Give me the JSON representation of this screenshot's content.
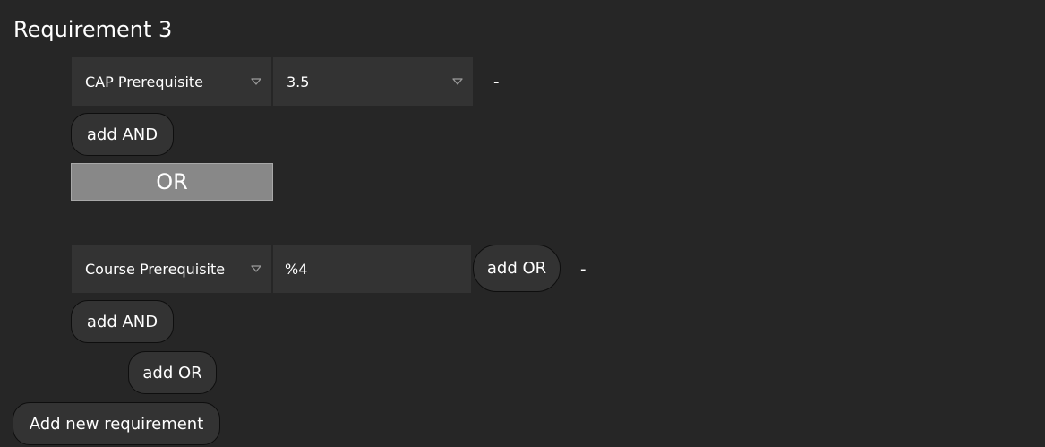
{
  "requirement": {
    "title": "Requirement 3"
  },
  "group1": {
    "type_select": {
      "value": "CAP Prerequisite",
      "icon": "caret-down-icon"
    },
    "value_select": {
      "value": "3.5",
      "icon": "caret-down-icon"
    },
    "remove_label": "-",
    "add_and_label": "add AND"
  },
  "or_separator": {
    "label": "OR"
  },
  "group2": {
    "type_select": {
      "value": "Course Prerequisite",
      "icon": "caret-down-icon"
    },
    "value_input": {
      "value": "%4"
    },
    "add_or_inline_label": "add OR",
    "remove_label": "-",
    "add_and_label": "add AND",
    "add_or_label": "add OR"
  },
  "footer": {
    "add_requirement_label": "Add new requirement"
  },
  "colors": {
    "background": "#262626",
    "field": "#333333",
    "or_bar": "#888888",
    "text": "#ffffff"
  }
}
